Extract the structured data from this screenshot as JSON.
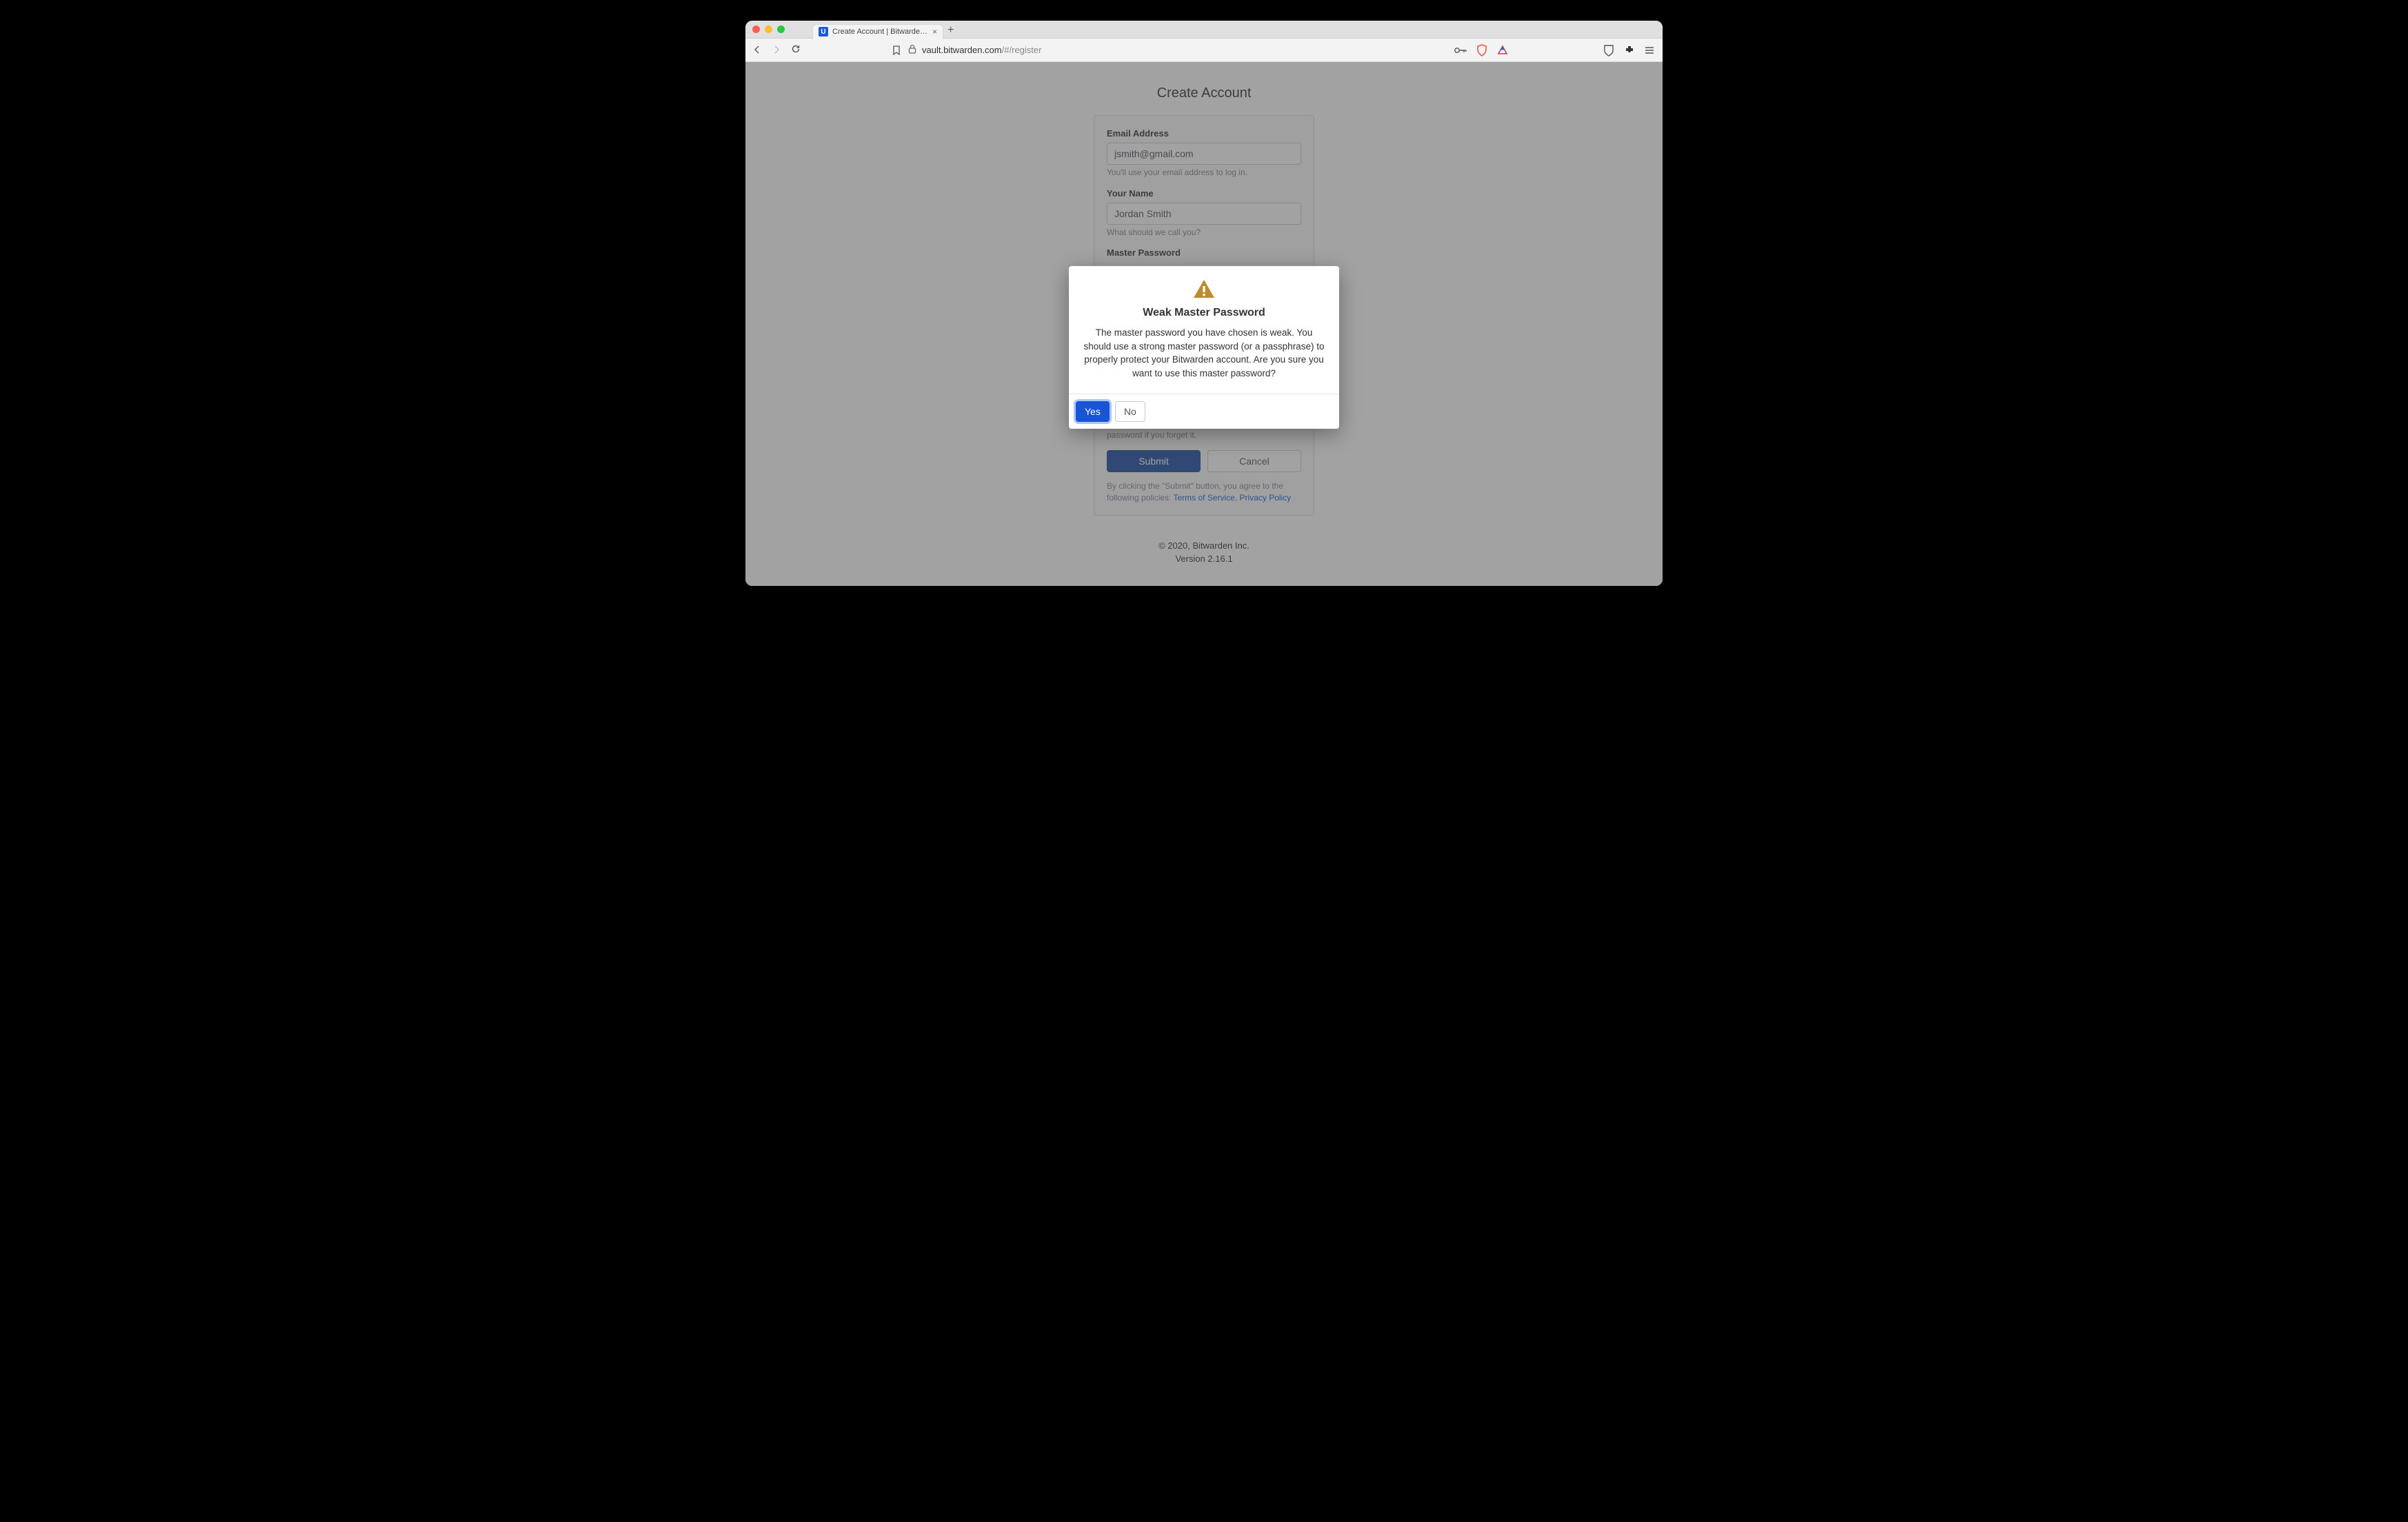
{
  "browser": {
    "tab_title": "Create Account | Bitwarden Web",
    "url_host": "vault.bitwarden.com",
    "url_path": "/#/register"
  },
  "page": {
    "title": "Create Account"
  },
  "form": {
    "email_label": "Email Address",
    "email_value": "jsmith@gmail.com",
    "email_hint": "You'll use your email address to log in.",
    "name_label": "Your Name",
    "name_value": "Jordan Smith",
    "name_hint": "What should we call you?",
    "mp_label": "Master Password",
    "hint_help": "A master password hint can help you remember your password if you forget it.",
    "submit": "Submit",
    "cancel": "Cancel",
    "legal_pre": "By clicking the \"Submit\" button, you agree to the following policies: ",
    "tos": "Terms of Service",
    "sep": ", ",
    "privacy": "Privacy Policy"
  },
  "footer": {
    "copyright": "© 2020, Bitwarden Inc.",
    "version": "Version 2.16.1"
  },
  "modal": {
    "title": "Weak Master Password",
    "text": "The master password you have chosen is weak. You should use a strong master password (or a passphrase) to properly protect your Bitwarden account. Are you sure you want to use this master password?",
    "yes": "Yes",
    "no": "No"
  }
}
